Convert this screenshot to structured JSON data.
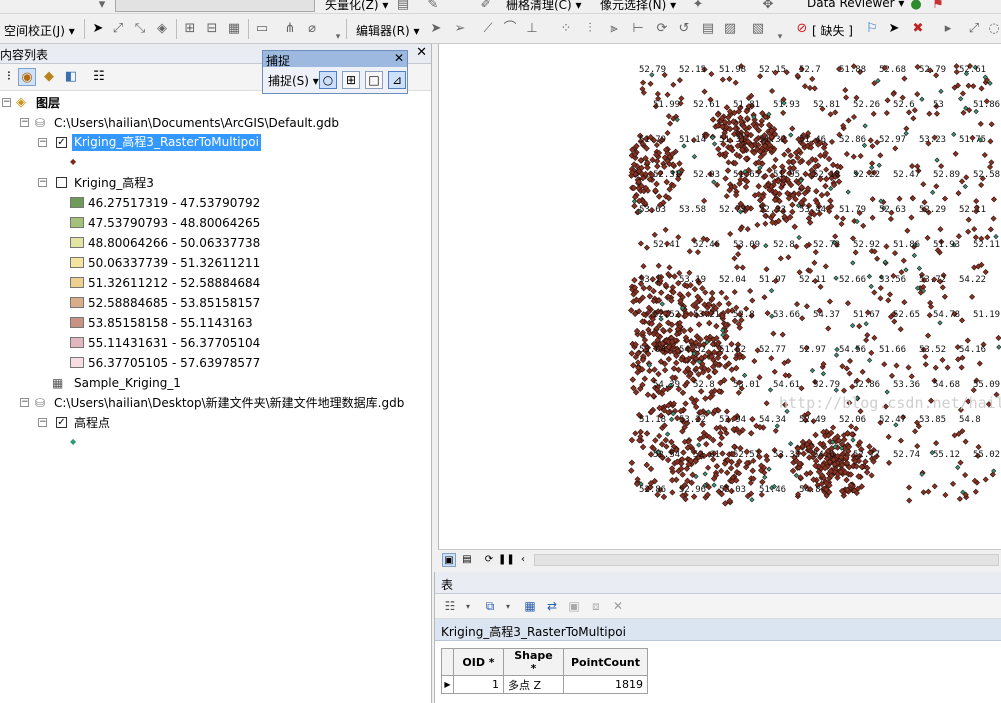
{
  "toolbar": {
    "row1": {
      "vectorize": "矢量化(Z) ▾",
      "raster_cleanup": "栅格清理(C) ▾",
      "cell_select": "像元选择(N) ▾",
      "data_reviewer": "Data Reviewer ▾"
    },
    "row2": {
      "spatial_adjust": "空间校正(J) ▾",
      "editor": "编辑器(R) ▾",
      "missing": "[ 缺失 ]"
    }
  },
  "toc": {
    "title": "内容列表",
    "layers_root": "图层",
    "gdb1": "C:\\Users\\hailian\\Documents\\ArcGIS\\Default.gdb",
    "layer_multipoint": "Kriging_高程3_RasterToMultipoi",
    "layer_raster": "Kriging_高程3",
    "legend": [
      {
        "range": "46.27517319 - 47.53790792",
        "color": "#6f9a5a"
      },
      {
        "range": "47.53790793 - 48.80064265",
        "color": "#a3c178"
      },
      {
        "range": "48.80064266 - 50.06337738",
        "color": "#e2e5a2"
      },
      {
        "range": "50.06337739 - 51.32611211",
        "color": "#f2e3a0"
      },
      {
        "range": "51.32611212 - 52.58884684",
        "color": "#eed08e"
      },
      {
        "range": "52.58884685 - 53.85158157",
        "color": "#d9ad88"
      },
      {
        "range": "53.85158158 - 55.1143163",
        "color": "#c89284"
      },
      {
        "range": "55.11431631 - 56.37705104",
        "color": "#e2b7bf"
      },
      {
        "range": "56.37705105 - 57.63978577",
        "color": "#f5dde2"
      }
    ],
    "table_sample": "Sample_Kriging_1",
    "gdb2": "C:\\Users\\hailian\\Desktop\\新建文件夹\\新建文件地理数据库.gdb",
    "layer_points": "高程点"
  },
  "snapping": {
    "title": "捕捉",
    "menu": "捕捉(S) ▾"
  },
  "map": {
    "watermark": "http://blog.csdn.net/hailiann",
    "labels": [
      {
        "t": "52.79"
      },
      {
        "t": "52.15"
      },
      {
        "t": "51.98"
      },
      {
        "t": "52.15"
      },
      {
        "t": "52.7"
      },
      {
        "t": "51.88"
      },
      {
        "t": "52.68"
      },
      {
        "t": "52.79"
      },
      {
        "t": "52.61"
      },
      {
        "t": "51.99"
      },
      {
        "t": "52.61"
      },
      {
        "t": "51.81"
      },
      {
        "t": "51.93"
      },
      {
        "t": "52.81"
      },
      {
        "t": "52.26"
      },
      {
        "t": "52.6"
      },
      {
        "t": "53"
      },
      {
        "t": "51.86"
      },
      {
        "t": "51.79"
      },
      {
        "t": "51.14"
      },
      {
        "t": "51.31"
      },
      {
        "t": "51.32"
      },
      {
        "t": "51.46"
      },
      {
        "t": "52.86"
      },
      {
        "t": "52.97"
      },
      {
        "t": "53.23"
      },
      {
        "t": "51.75"
      },
      {
        "t": "52.31"
      },
      {
        "t": "52.03"
      },
      {
        "t": "51.65"
      },
      {
        "t": "51.95"
      },
      {
        "t": "52.18"
      },
      {
        "t": "52.22"
      },
      {
        "t": "52.47"
      },
      {
        "t": "52.89"
      },
      {
        "t": "52.58"
      },
      {
        "t": "53.63"
      },
      {
        "t": "53.58"
      },
      {
        "t": "52.73"
      },
      {
        "t": "52.33"
      },
      {
        "t": "53.44"
      },
      {
        "t": "51.79"
      },
      {
        "t": "52.63"
      },
      {
        "t": "52.29"
      },
      {
        "t": "52.11"
      },
      {
        "t": "52.41"
      },
      {
        "t": "52.46"
      },
      {
        "t": "53.09"
      },
      {
        "t": "52.8"
      },
      {
        "t": "52.72"
      },
      {
        "t": "52.92"
      },
      {
        "t": "51.86"
      },
      {
        "t": "51.93"
      },
      {
        "t": "52.11"
      },
      {
        "t": "53.1"
      },
      {
        "t": "53.19"
      },
      {
        "t": "52.04"
      },
      {
        "t": "51.97"
      },
      {
        "t": "52.11"
      },
      {
        "t": "52.66"
      },
      {
        "t": "53.56"
      },
      {
        "t": "53.72"
      },
      {
        "t": "54.22"
      },
      {
        "t": "52.52"
      },
      {
        "t": "53.21"
      },
      {
        "t": "52.8"
      },
      {
        "t": "53.66"
      },
      {
        "t": "54.37"
      },
      {
        "t": "51.67"
      },
      {
        "t": "52.65"
      },
      {
        "t": "54.78"
      },
      {
        "t": "51.19"
      },
      {
        "t": "53.64"
      },
      {
        "t": "54.52"
      },
      {
        "t": "51.62"
      },
      {
        "t": "52.77"
      },
      {
        "t": "52.97"
      },
      {
        "t": "54.56"
      },
      {
        "t": "51.66"
      },
      {
        "t": "53.52"
      },
      {
        "t": "54.16"
      },
      {
        "t": "54.39"
      },
      {
        "t": "52.8"
      },
      {
        "t": "53.01"
      },
      {
        "t": "54.61"
      },
      {
        "t": "52.79"
      },
      {
        "t": "52.86"
      },
      {
        "t": "53.36"
      },
      {
        "t": "54.68"
      },
      {
        "t": "55.09"
      },
      {
        "t": "51.18"
      },
      {
        "t": "53.22"
      },
      {
        "t": "53.94"
      },
      {
        "t": "54.34"
      },
      {
        "t": "52.49"
      },
      {
        "t": "52.06"
      },
      {
        "t": "52.47"
      },
      {
        "t": "53.85"
      },
      {
        "t": "54.8"
      },
      {
        "t": "52.54"
      },
      {
        "t": "52.61"
      },
      {
        "t": "52.57"
      },
      {
        "t": "53.32"
      },
      {
        "t": "54.6"
      },
      {
        "t": "52.77"
      },
      {
        "t": "52.74"
      },
      {
        "t": "55.12"
      },
      {
        "t": "55.02"
      },
      {
        "t": "52.86"
      },
      {
        "t": "52.96"
      },
      {
        "t": "55.03"
      },
      {
        "t": "51.46"
      },
      {
        "t": "54.8"
      }
    ]
  },
  "table": {
    "panel_title": "表",
    "tab_name": "Kriging_高程3_RasterToMultipoi",
    "columns": [
      "OID *",
      "Shape *",
      "PointCount"
    ],
    "rows": [
      {
        "oid": "1",
        "shape": "多点 Z",
        "count": "1819"
      }
    ]
  }
}
